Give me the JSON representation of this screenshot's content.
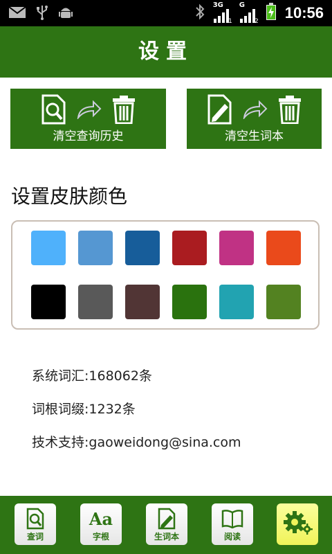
{
  "status_bar": {
    "time": "10:56",
    "net1": "3G",
    "net2": "G",
    "sim1": "1",
    "sim2": "2"
  },
  "title": "设置",
  "actions": [
    {
      "label": "清空查询历史"
    },
    {
      "label": "清空生词本"
    }
  ],
  "skin": {
    "title": "设置皮肤颜色",
    "colors": [
      "#4fb1fb",
      "#5597d2",
      "#175d9a",
      "#aa1c20",
      "#c03284",
      "#ea4a1b",
      "#000000",
      "#595959",
      "#513535",
      "#2a720e",
      "#22a3b1",
      "#538221"
    ]
  },
  "info": {
    "system_words": "系统词汇:168062条",
    "root_affix": "词根词缀:1232条",
    "support": "技术支持:gaoweidong@sina.com"
  },
  "tabs": [
    {
      "label": "查词",
      "icon_text": ""
    },
    {
      "label": "字根",
      "icon_text": "Aa"
    },
    {
      "label": "生词本",
      "icon_text": ""
    },
    {
      "label": "阅读",
      "icon_text": ""
    },
    {
      "label": "",
      "icon_text": ""
    }
  ],
  "colors": {
    "brand_green": "#2e7414",
    "active_tab": "#f0f35a"
  }
}
